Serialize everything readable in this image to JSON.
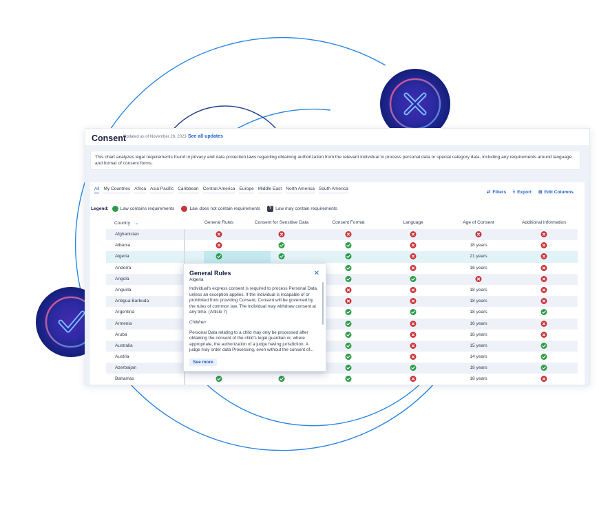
{
  "header": {
    "title": "Consent",
    "updated": "Updated as of November 28, 2023",
    "see_all": "See all updates"
  },
  "description": "This chart analyzes legal requirements found in privacy and data protection laws regarding obtaining authorization from the relevant individual to process personal data or special category data, including any requirements around language and format of consent forms.",
  "tabs": [
    "All",
    "My Countries",
    "Africa",
    "Asia Pacific",
    "Caribbean",
    "Central America",
    "Europe",
    "Middle East",
    "North America",
    "South America"
  ],
  "tools": {
    "filters": "Filters",
    "export": "Export",
    "edit_columns": "Edit Columns"
  },
  "legend": {
    "label": "Legend:",
    "yes": "Law contains requirements",
    "no": "Law does not contain requirements",
    "maybe": "Law may contain requirements"
  },
  "columns": [
    "Country",
    "General Rules",
    "Consent for Sensitive Data",
    "Consent Format",
    "Language",
    "Age of Consent",
    "Additional Information"
  ],
  "rows": [
    {
      "country": "Afghanistan",
      "cells": [
        "no",
        "no",
        "no",
        "no",
        "no",
        "no"
      ]
    },
    {
      "country": "Albania",
      "cells": [
        "no",
        "yes",
        "yes",
        "no",
        "18 years",
        "no"
      ]
    },
    {
      "country": "Algeria",
      "cells": [
        "yes",
        "yes",
        "yes",
        "no",
        "21 years",
        "no"
      ]
    },
    {
      "country": "Andorra",
      "cells": [
        "",
        "",
        "yes",
        "no",
        "16 years",
        "no"
      ]
    },
    {
      "country": "Angola",
      "cells": [
        "",
        "",
        "yes",
        "yes",
        "no",
        "no"
      ]
    },
    {
      "country": "Anguilla",
      "cells": [
        "",
        "",
        "no",
        "no",
        "18 years",
        "no"
      ]
    },
    {
      "country": "Antigua Barbuda",
      "cells": [
        "",
        "",
        "no",
        "no",
        "18 years",
        "no"
      ]
    },
    {
      "country": "Argentina",
      "cells": [
        "",
        "",
        "yes",
        "yes",
        "18 years",
        "yes"
      ]
    },
    {
      "country": "Armenia",
      "cells": [
        "",
        "",
        "yes",
        "no",
        "16 years",
        "no"
      ]
    },
    {
      "country": "Aruba",
      "cells": [
        "",
        "",
        "yes",
        "no",
        "18 years",
        "no"
      ]
    },
    {
      "country": "Australia",
      "cells": [
        "",
        "",
        "yes",
        "no",
        "15 years",
        "yes"
      ]
    },
    {
      "country": "Austria",
      "cells": [
        "",
        "",
        "yes",
        "no",
        "14 years",
        "yes"
      ]
    },
    {
      "country": "Azerbaijan",
      "cells": [
        "",
        "",
        "yes",
        "yes",
        "18 years",
        "yes"
      ]
    },
    {
      "country": "Bahamas",
      "cells": [
        "yes",
        "yes",
        "yes",
        "no",
        "18 years",
        "no"
      ]
    }
  ],
  "popup": {
    "title": "General Rules",
    "subtitle": "Algeria",
    "para1": "Individual's express consent is required to process Personal Data, unless an exception applies. If the individual is incapable of or prohibited from providing Consent, Consent will be governed by the rules of common law. The individual may withdraw consent at any time. (Article 7)",
    "section": "Children",
    "para2": "Personal Data relating to a child may only be processed after obtaining the consent of the child's legal guardian or, where appropriate, the authorization of a judge having jurisdiction. A judge may order data Processing, even without the consent of...",
    "see_more": "See more"
  },
  "colors": {
    "accent": "#1f5fd1",
    "yes": "#2e9b4a",
    "no": "#c8353c",
    "ring": "#2a86e0",
    "badge": "#14207a"
  }
}
